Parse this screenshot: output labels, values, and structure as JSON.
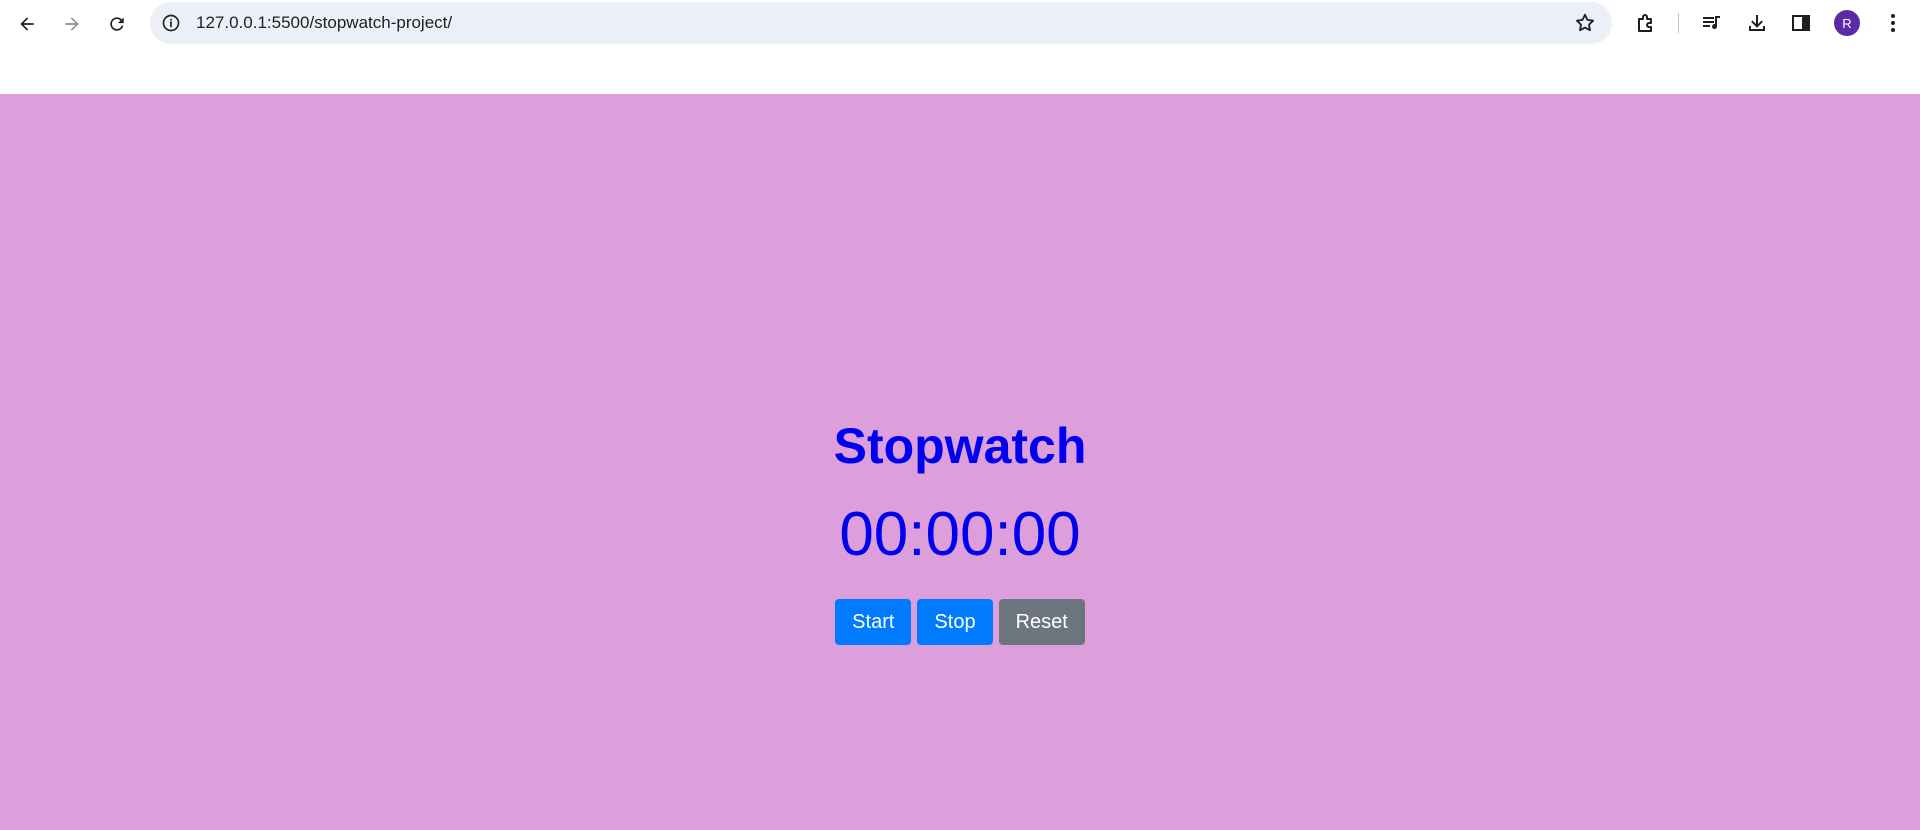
{
  "browser": {
    "url": "127.0.0.1:5500/stopwatch-project/",
    "profile_initial": "R",
    "avatar_color": "#5b2aa6",
    "icons": [
      "back-arrow-icon",
      "forward-arrow-icon",
      "reload-icon",
      "site-info-icon",
      "bookmark-star-icon",
      "extensions-icon",
      "media-queue-icon",
      "download-icon",
      "side-panel-icon",
      "kebab-menu-icon"
    ]
  },
  "page": {
    "background_color": "#dc9fdc",
    "title": "Stopwatch",
    "time_display": "00:00:00",
    "text_color": "#0000ee",
    "buttons": {
      "start_label": "Start",
      "stop_label": "Stop",
      "reset_label": "Reset"
    },
    "button_colors": {
      "primary": "#007bff",
      "secondary": "#6c757d"
    }
  }
}
